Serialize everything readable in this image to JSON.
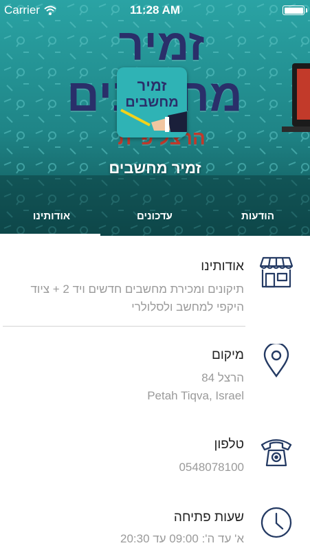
{
  "status_bar": {
    "carrier": "Carrier",
    "time": "11:28 AM"
  },
  "header": {
    "banner_line1": "זמיר",
    "banner_line2": "מחשבים",
    "banner_line3": "הרצל פ\"ת",
    "logo_line1": "זמיר",
    "logo_line2": "מחשבים",
    "business_name": "זמיר מחשבים",
    "tabs": [
      {
        "label": "הודעות",
        "selected": false
      },
      {
        "label": "עדכונים",
        "selected": false
      },
      {
        "label": "אודותינו",
        "selected": true
      }
    ]
  },
  "about": {
    "title": "אודותינו",
    "line1": "תיקונים ומכירת מחשבים חדשים ויד 2 + ציוד",
    "line2": "היקפי למחשב ולסלולרי"
  },
  "location": {
    "title": "מיקום",
    "line1": "הרצל 84",
    "line2": "Petah Tiqva, Israel"
  },
  "phone": {
    "title": "טלפון",
    "number": "0548078100"
  },
  "hours": {
    "title": "שעות פתיחה",
    "line1": "א' עד ה': 09:00 עד 20:30"
  },
  "colors": {
    "hero_teal": "#1f8a8c",
    "icon_navy": "#243a63",
    "text_gray": "#9a9a9a"
  }
}
